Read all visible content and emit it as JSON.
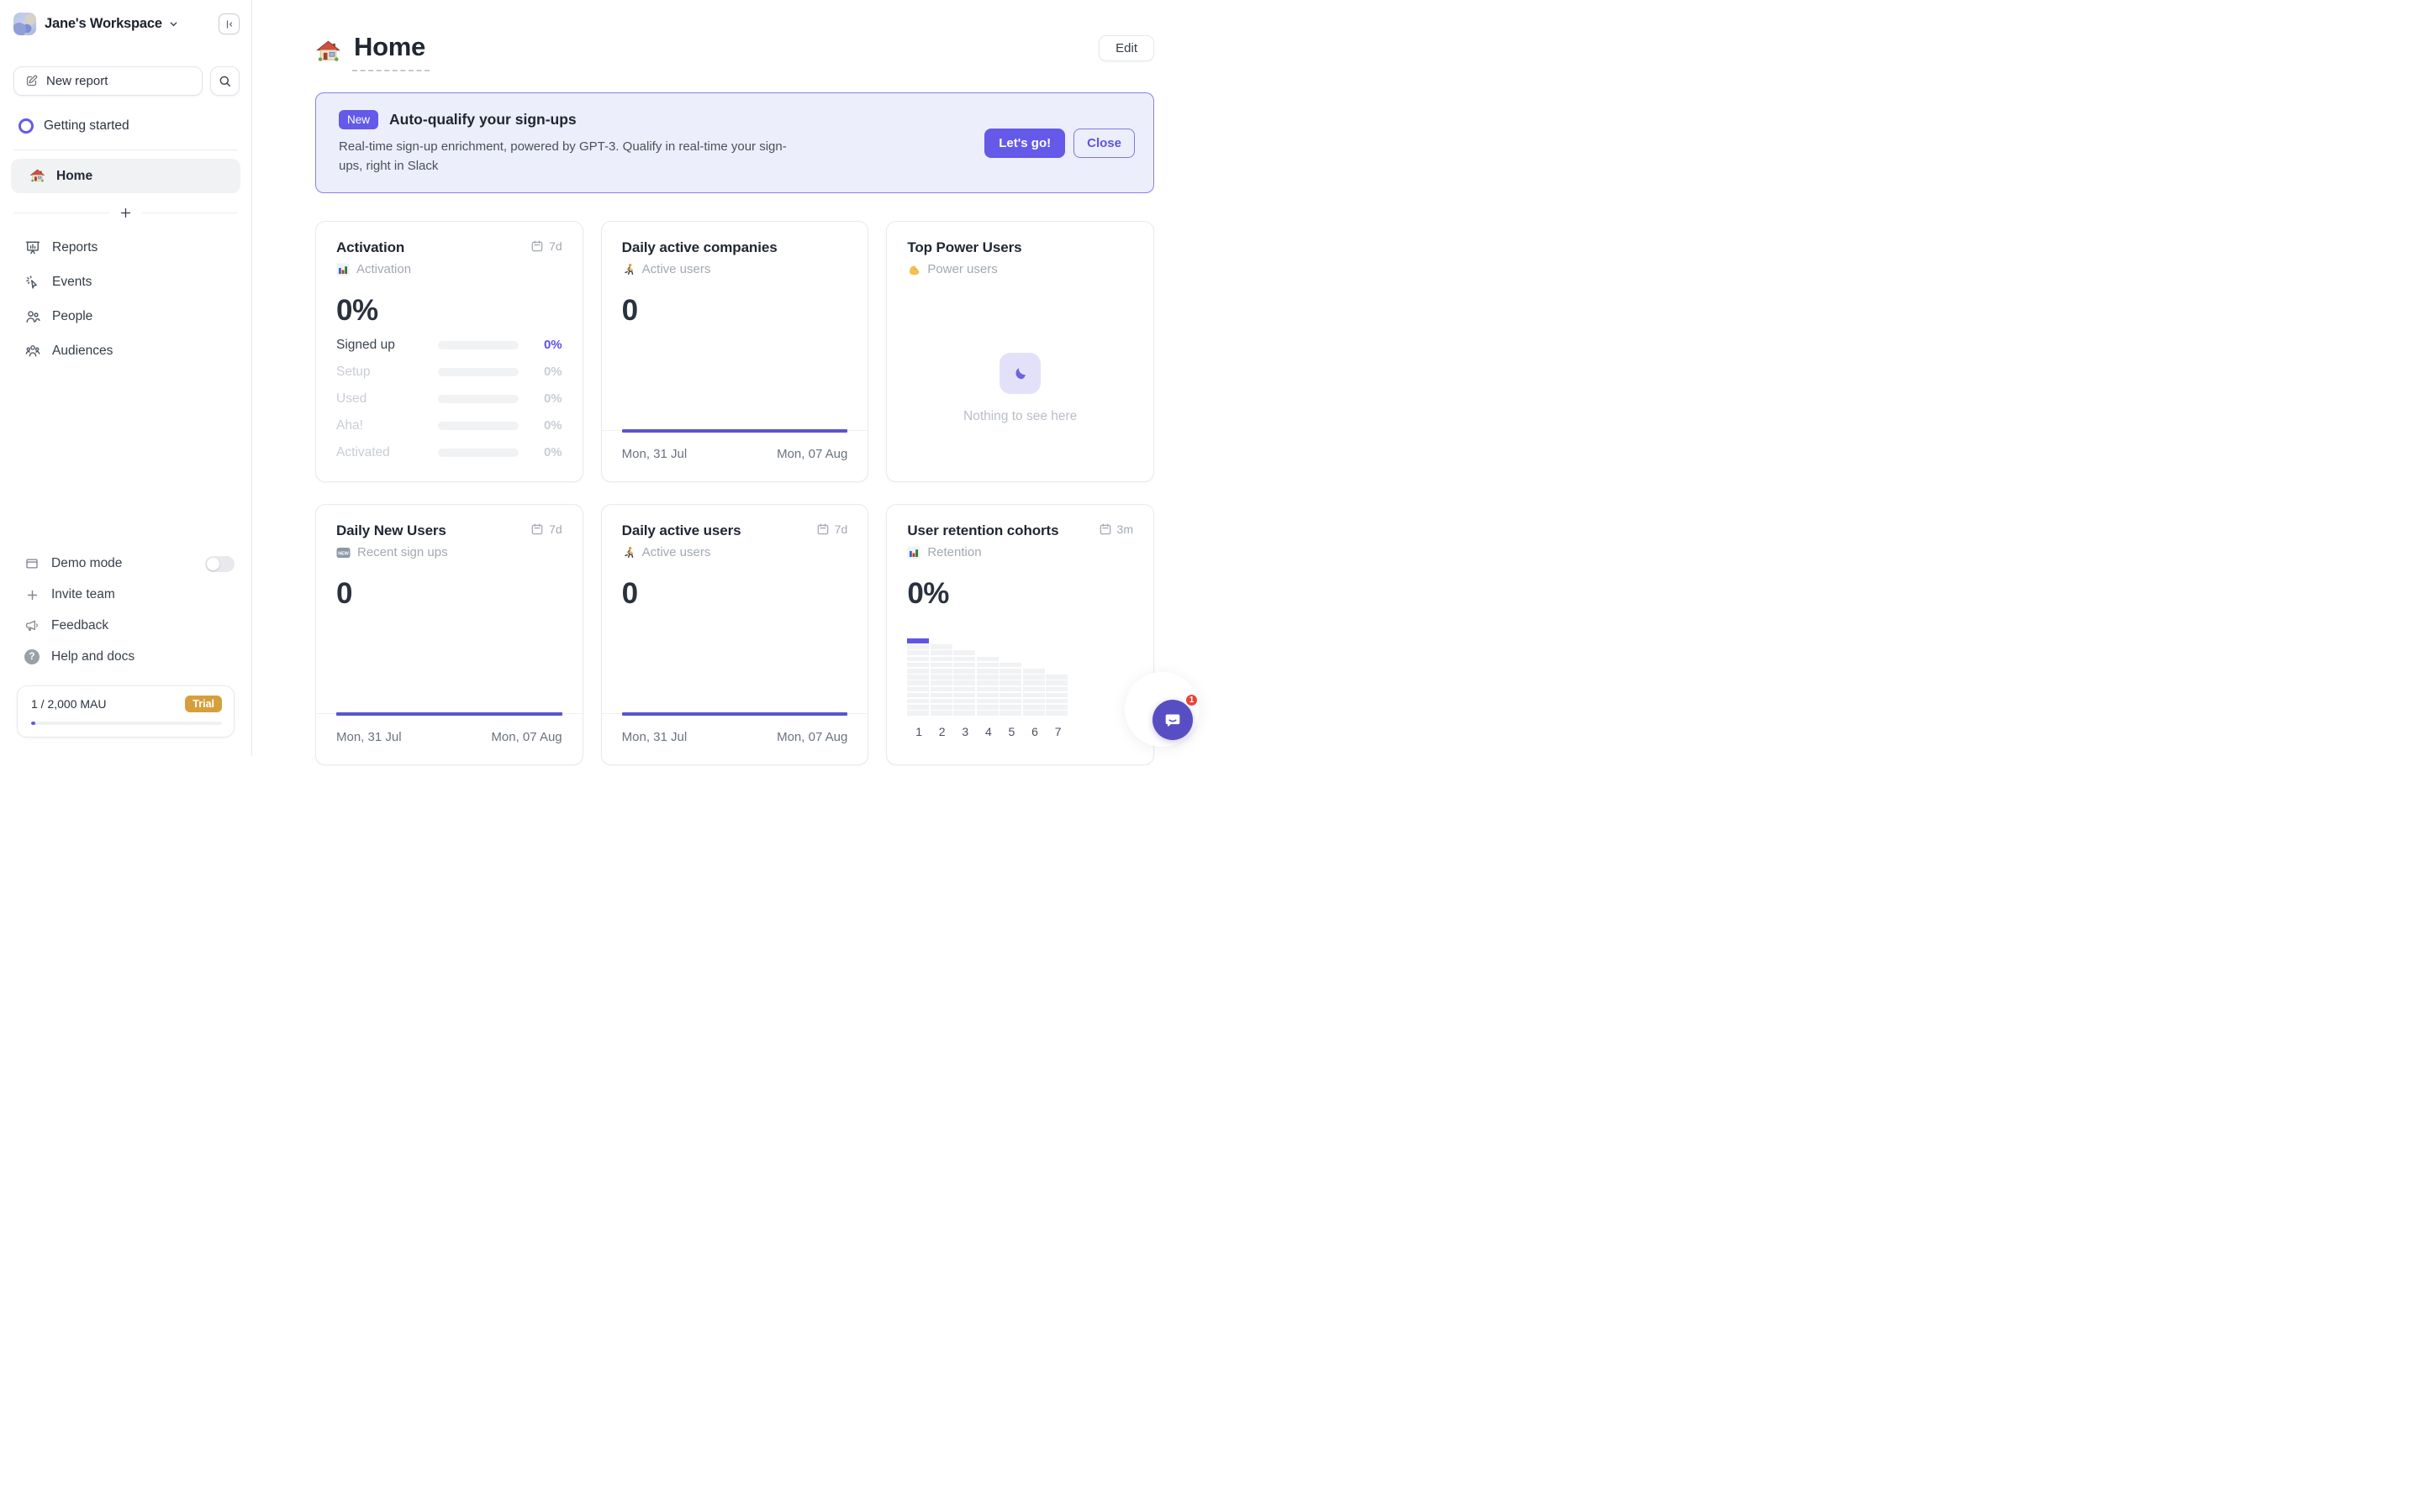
{
  "app": {
    "accent_color": "#6459e8"
  },
  "sidebar": {
    "workspace_name": "Jane's Workspace",
    "new_report_label": "New report",
    "getting_started_label": "Getting started",
    "home_label": "Home",
    "nav": [
      {
        "icon": "reports-icon",
        "label": "Reports"
      },
      {
        "icon": "events-icon",
        "label": "Events"
      },
      {
        "icon": "people-icon",
        "label": "People"
      },
      {
        "icon": "audiences-icon",
        "label": "Audiences"
      }
    ],
    "footer": [
      {
        "icon": "demo-window-icon",
        "label": "Demo mode",
        "toggle_state": "off"
      },
      {
        "icon": "plus-icon",
        "label": "Invite team"
      },
      {
        "icon": "megaphone-icon",
        "label": "Feedback"
      },
      {
        "icon": "help-icon",
        "label": "Help and docs"
      }
    ],
    "usage": {
      "label": "1 / 2,000 MAU",
      "badge": "Trial"
    }
  },
  "header": {
    "icon": "house-icon",
    "title": "Home",
    "edit_label": "Edit"
  },
  "banner": {
    "badge": "New",
    "title": "Auto-qualify your sign-ups",
    "description": "Real-time sign-up enrichment, powered by GPT-3. Qualify in real-time your sign-ups, right in Slack",
    "primary_label": "Let's go!",
    "secondary_label": "Close"
  },
  "cards": {
    "activation": {
      "title": "Activation",
      "range": "7d",
      "metric_icon": "bar-chart-icon",
      "metric_label": "Activation",
      "value": "0%",
      "funnel": [
        {
          "label": "Signed up",
          "value": "0%"
        },
        {
          "label": "Setup",
          "value": "0%"
        },
        {
          "label": "Used",
          "value": "0%"
        },
        {
          "label": "Aha!",
          "value": "0%"
        },
        {
          "label": "Activated",
          "value": "0%"
        }
      ]
    },
    "daily_active_companies": {
      "title": "Daily active companies",
      "metric_icon": "runner-icon",
      "metric_label": "Active users",
      "value": "0",
      "chart": {
        "type": "line",
        "series_value": 0,
        "start_date": "Mon, 31 Jul",
        "end_date": "Mon, 07 Aug"
      }
    },
    "top_power_users": {
      "title": "Top Power Users",
      "metric_icon": "biceps-icon",
      "metric_label": "Power users",
      "empty_icon": "moon-icon",
      "empty_text": "Nothing to see here"
    },
    "daily_new_users": {
      "title": "Daily New Users",
      "range": "7d",
      "metric_icon": "new-sign-icon",
      "metric_label": "Recent sign ups",
      "value": "0",
      "chart": {
        "type": "line",
        "series_value": 0,
        "start_date": "Mon, 31 Jul",
        "end_date": "Mon, 07 Aug"
      }
    },
    "daily_active_users": {
      "title": "Daily active users",
      "range": "7d",
      "metric_icon": "runner-icon",
      "metric_label": "Active users",
      "value": "0",
      "chart": {
        "type": "line",
        "series_value": 0,
        "start_date": "Mon, 31 Jul",
        "end_date": "Mon, 07 Aug"
      }
    },
    "retention": {
      "title": "User retention cohorts",
      "range": "3m",
      "metric_icon": "bar-chart-icon",
      "metric_label": "Retention",
      "value": "0%",
      "cohort": {
        "rows": 13,
        "columns": 7,
        "highlight_color": "#6156e4",
        "cell_color": "#f1f2f4"
      },
      "axis": [
        "1",
        "2",
        "3",
        "4",
        "5",
        "6",
        "7"
      ]
    }
  },
  "intercom": {
    "unread_count": "1"
  }
}
